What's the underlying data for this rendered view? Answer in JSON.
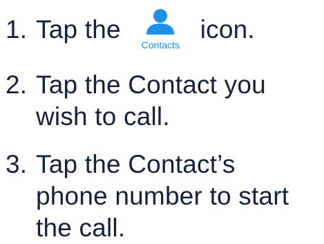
{
  "steps": [
    {
      "number": "1.",
      "before_icon": "Tap the",
      "icon": {
        "name": "contacts-person-icon",
        "label": "Contacts",
        "color": "#1e90e6"
      },
      "after_icon": "icon."
    },
    {
      "number": "2.",
      "lines": [
        "Tap the Contact you",
        "wish to call."
      ]
    },
    {
      "number": "3.",
      "lines": [
        "Tap the Contact’s",
        "phone number to start",
        "the call."
      ]
    }
  ],
  "colors": {
    "text": "#15203a",
    "accent": "#1e90e6",
    "background": "#ffffff"
  }
}
